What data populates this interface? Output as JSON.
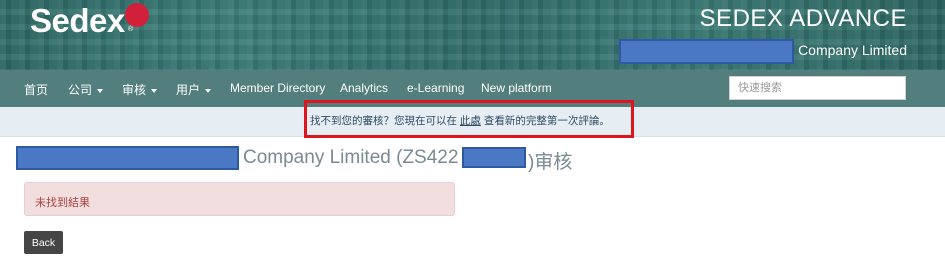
{
  "header": {
    "logo_text": "Sedex",
    "logo_trademark": "®",
    "product_title": "SEDEX ADVANCE",
    "company_name": "Company Limited",
    "brand_color": "#d3203a"
  },
  "nav": {
    "items": [
      {
        "label": "首页"
      },
      {
        "label": "公司"
      },
      {
        "label": "审核"
      },
      {
        "label": "用户"
      },
      {
        "label": "Member Directory"
      },
      {
        "label": "Analytics"
      },
      {
        "label": "e-Learning"
      },
      {
        "label": "New platform"
      }
    ],
    "search_placeholder": "快速搜索"
  },
  "notice": {
    "text_before": "找不到您的審核？您現在可以在 ",
    "link_text": "此處",
    "text_after": " 查看新的完整第一次評論。"
  },
  "page": {
    "title_part1": "Company Limited (ZS422",
    "title_part2": ")审核"
  },
  "alert": {
    "message": "未找到結果"
  },
  "actions": {
    "back_label": "Back"
  }
}
